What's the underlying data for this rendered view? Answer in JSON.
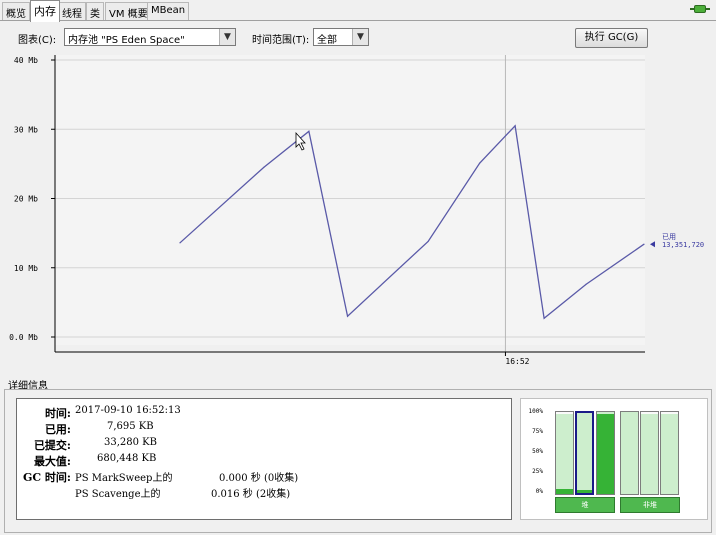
{
  "tabs": [
    {
      "label": "概览"
    },
    {
      "label": "内存"
    },
    {
      "label": "线程"
    },
    {
      "label": "类"
    },
    {
      "label": "VM 概要"
    },
    {
      "label": "MBean"
    }
  ],
  "controls": {
    "chart_label": "图表(C):",
    "chart_value": "内存池 \"PS Eden Space\"",
    "range_label": "时间范围(T):",
    "range_value": "全部",
    "gc_button": "执行 GC(G)"
  },
  "chart_data": {
    "type": "line",
    "y_ticks": [
      "40 Mb",
      "30 Mb",
      "20 Mb",
      "10 Mb",
      "0.0 Mb"
    ],
    "y_tick_values": [
      40,
      30,
      20,
      10,
      0
    ],
    "ylim": [
      0,
      40
    ],
    "x_tick": "16:52",
    "series": [
      {
        "name": "已用",
        "color": "#5a5aa8",
        "x": [
          0,
          1.3,
          2.0,
          2.6,
          3.85,
          4.65,
          5.2,
          5.65,
          6.3,
          7.2
        ],
        "values": [
          13.6,
          24.5,
          29.7,
          3.0,
          13.8,
          25.1,
          30.5,
          2.7,
          7.6,
          13.4
        ]
      }
    ],
    "marker_x": 5.05,
    "annotation": {
      "label": "已用",
      "value": "13,351,720"
    },
    "grid": true
  },
  "details": {
    "title": "详细信息",
    "time_label": "时间:",
    "time_value": "2017-09-10 16:52:13",
    "used_label": "已用:",
    "used_value": "7,695 KB",
    "committed_label": "已提交:",
    "committed_value": "33,280 KB",
    "max_label": "最大值:",
    "max_value": "680,448 KB",
    "gc_label": "GC 时间:",
    "gc_items": [
      {
        "name": "PS MarkSweep上的",
        "time": "0.000 秒 (0收集)"
      },
      {
        "name": "PS Scavenge上的",
        "time": "0.016 秒 (2收集)"
      }
    ]
  },
  "pools": {
    "percent_labels": [
      "100%",
      "75%",
      "50%",
      "25%",
      "0%"
    ],
    "heap_label": "堆",
    "nonheap_label": "非堆",
    "heap_bars": [
      {
        "committed": 0.98,
        "used": 0.06
      },
      {
        "committed": 1.0,
        "used": 0.04
      },
      {
        "committed": 1.0,
        "used": 0.98
      }
    ],
    "nonheap_bars": [
      {
        "committed": 1.0,
        "used": 0.0
      },
      {
        "committed": 0.98,
        "used": 0.0
      },
      {
        "committed": 0.98,
        "used": 0.0
      }
    ]
  }
}
